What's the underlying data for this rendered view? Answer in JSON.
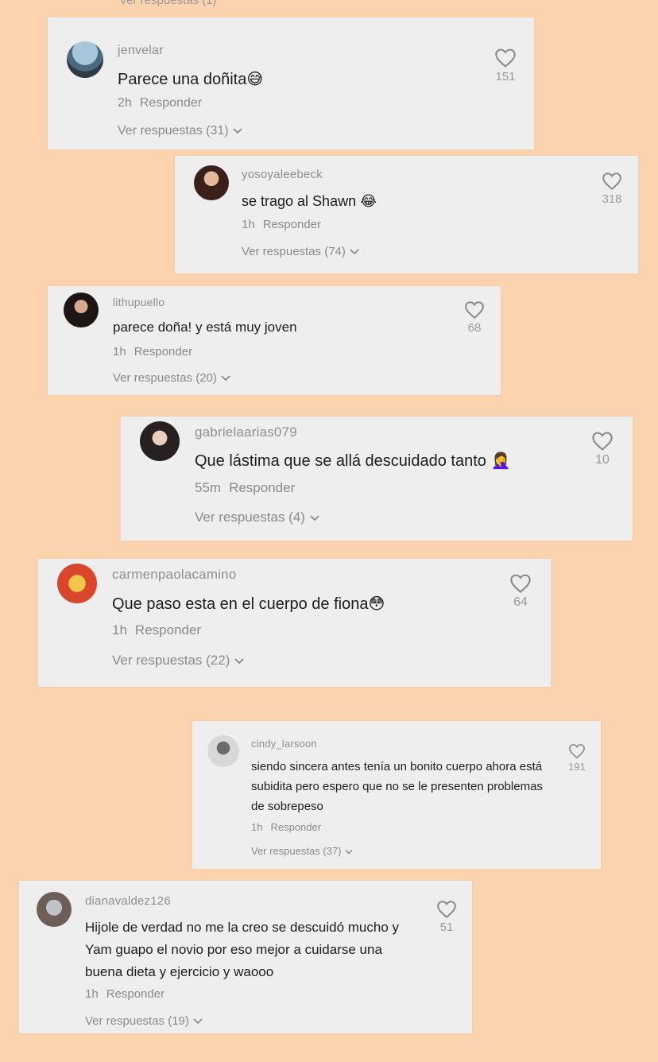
{
  "top_cutoff_text": "Ver respuestas (1)",
  "reply_label": "Responder",
  "comments": [
    {
      "username": "jenvelar",
      "text": "Parece una doñita😅",
      "time": "2h",
      "replies": "Ver respuestas (31)",
      "likes": "151"
    },
    {
      "username": "yosoyaleebeck",
      "text": "se trago al Shawn 😂",
      "time": "1h",
      "replies": "Ver respuestas (74)",
      "likes": "318"
    },
    {
      "username": "lithupuello",
      "text": "parece doña! y está muy joven",
      "time": "1h",
      "replies": "Ver respuestas (20)",
      "likes": "68"
    },
    {
      "username": "gabrielaarias079",
      "text": "Que lástima que se allá descuidado tanto 🤦‍♀️",
      "time": "55m",
      "replies": "Ver respuestas (4)",
      "likes": "10"
    },
    {
      "username": "carmenpaolacamino",
      "text": "Que paso esta en el cuerpo de fiona😳",
      "time": "1h",
      "replies": "Ver respuestas (22)",
      "likes": "64"
    },
    {
      "username": "cindy_larsoon",
      "text": "siendo sincera antes tenía un bonito cuerpo ahora está subidita pero espero que no se le presenten problemas de sobrepeso",
      "time": "1h",
      "replies": "Ver respuestas (37)",
      "likes": "191"
    },
    {
      "username": "dianavaldez126",
      "text": "Hijole de verdad no me la creo se descuidó mucho y Yam guapo el novio por eso mejor a cuidarse una buena dieta y ejercicio y waooo",
      "time": "1h",
      "replies": "Ver respuestas (19)",
      "likes": "51"
    }
  ],
  "colors": {
    "background": "#fbd3ae",
    "card": "#eeeeef",
    "secondary_text": "#8a8a8a"
  },
  "icons": [
    "heart-outline-icon",
    "chevron-down-icon"
  ]
}
